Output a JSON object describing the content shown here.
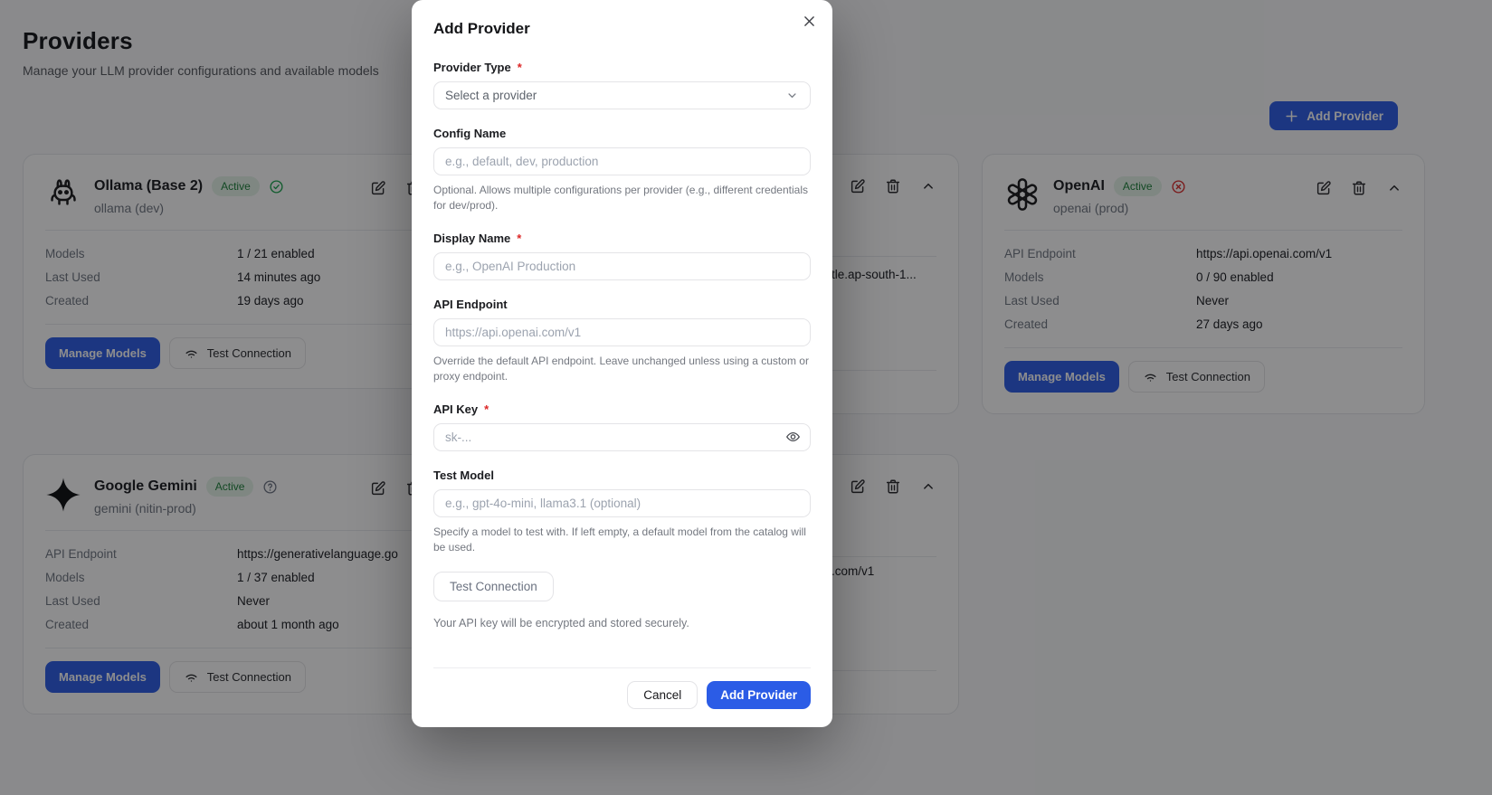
{
  "colors": {
    "primary_blue": "#2b5ce6",
    "badge_green_bg": "#e4f4e9",
    "badge_green_text": "#1a7f37",
    "status_check_green": "#16a34a",
    "status_x_red": "#dc2626",
    "page_bg": "#f9fafb",
    "card_border": "#e5e7eb",
    "overlay": "rgba(12,12,14,0.47)"
  },
  "header": {
    "title": "Providers",
    "subtitle": "Manage your LLM provider configurations and available models",
    "add_provider_label": "Add Provider"
  },
  "cards": {
    "ollama": {
      "name": "Ollama (Base 2)",
      "badge": "Active",
      "status_icon": "check-circle",
      "subtitle": "ollama (dev)",
      "rows": [
        {
          "label": "Models",
          "value": "1 / 21 enabled"
        },
        {
          "label": "Last Used",
          "value": "14 minutes ago"
        },
        {
          "label": "Created",
          "value": "19 days ago"
        }
      ],
      "manage_models_label": "Manage Models",
      "test_connection_label": "Test Connection"
    },
    "gemini": {
      "name": "Google Gemini",
      "badge": "Active",
      "status_icon": "help-circle",
      "subtitle": "gemini (nitin-prod)",
      "rows": [
        {
          "label": "API Endpoint",
          "value": "https://generativelanguage.go"
        },
        {
          "label": "Models",
          "value": "1 / 37 enabled"
        },
        {
          "label": "Last Used",
          "value": "Never"
        },
        {
          "label": "Created",
          "value": "about 1 month ago"
        }
      ],
      "manage_models_label": "Manage Models",
      "test_connection_label": "Test Connection"
    },
    "openai": {
      "name": "OpenAI",
      "badge": "Active",
      "status_icon": "x-circle",
      "subtitle": "openai (prod)",
      "rows": [
        {
          "label": "API Endpoint",
          "value": "https://api.openai.com/v1"
        },
        {
          "label": "Models",
          "value": "0 / 90 enabled"
        },
        {
          "label": "Last Used",
          "value": "Never"
        },
        {
          "label": "Created",
          "value": "27 days ago"
        }
      ],
      "manage_models_label": "Manage Models",
      "test_connection_label": "Test Connection"
    },
    "hidden_middle_top": {
      "endpoint_fragment": "tle.ap-south-1..."
    },
    "hidden_middle_bottom": {
      "endpoint_fragment": ".com/v1"
    }
  },
  "modal": {
    "title": "Add Provider",
    "required_mark": "*",
    "fields": {
      "provider_type": {
        "label": "Provider Type",
        "value": "Select a provider"
      },
      "config_name": {
        "label": "Config Name",
        "placeholder": "e.g., default, dev, production",
        "helper": "Optional. Allows multiple configurations per provider (e.g., different credentials for dev/prod)."
      },
      "display_name": {
        "label": "Display Name",
        "placeholder": "e.g., OpenAI Production"
      },
      "api_endpoint": {
        "label": "API Endpoint",
        "placeholder": "https://api.openai.com/v1",
        "helper": "Override the default API endpoint. Leave unchanged unless using a custom or proxy endpoint."
      },
      "api_key": {
        "label": "API Key",
        "placeholder": "sk-..."
      },
      "test_model": {
        "label": "Test Model",
        "placeholder": "e.g., gpt-4o-mini, llama3.1 (optional)",
        "helper": "Specify a model to test with. If left empty, a default model from the catalog will be used."
      }
    },
    "test_connection_label": "Test Connection",
    "security_note": "Your API key will be encrypted and stored securely.",
    "cancel_label": "Cancel",
    "submit_label": "Add Provider"
  },
  "icons": {
    "plus": "plus-icon",
    "close": "close-icon",
    "chevron_down": "chevron-down-icon",
    "chevron_up": "chevron-up-icon",
    "edit": "edit-icon",
    "trash": "trash-icon",
    "wifi": "wifi-icon",
    "eye": "eye-icon",
    "check": "check-circle-icon",
    "x": "x-circle-icon",
    "help": "help-circle-icon",
    "ollama_logo": "ollama-llama-icon",
    "openai_logo": "openai-logo-icon",
    "gemini_logo": "gemini-sparkle-icon"
  }
}
